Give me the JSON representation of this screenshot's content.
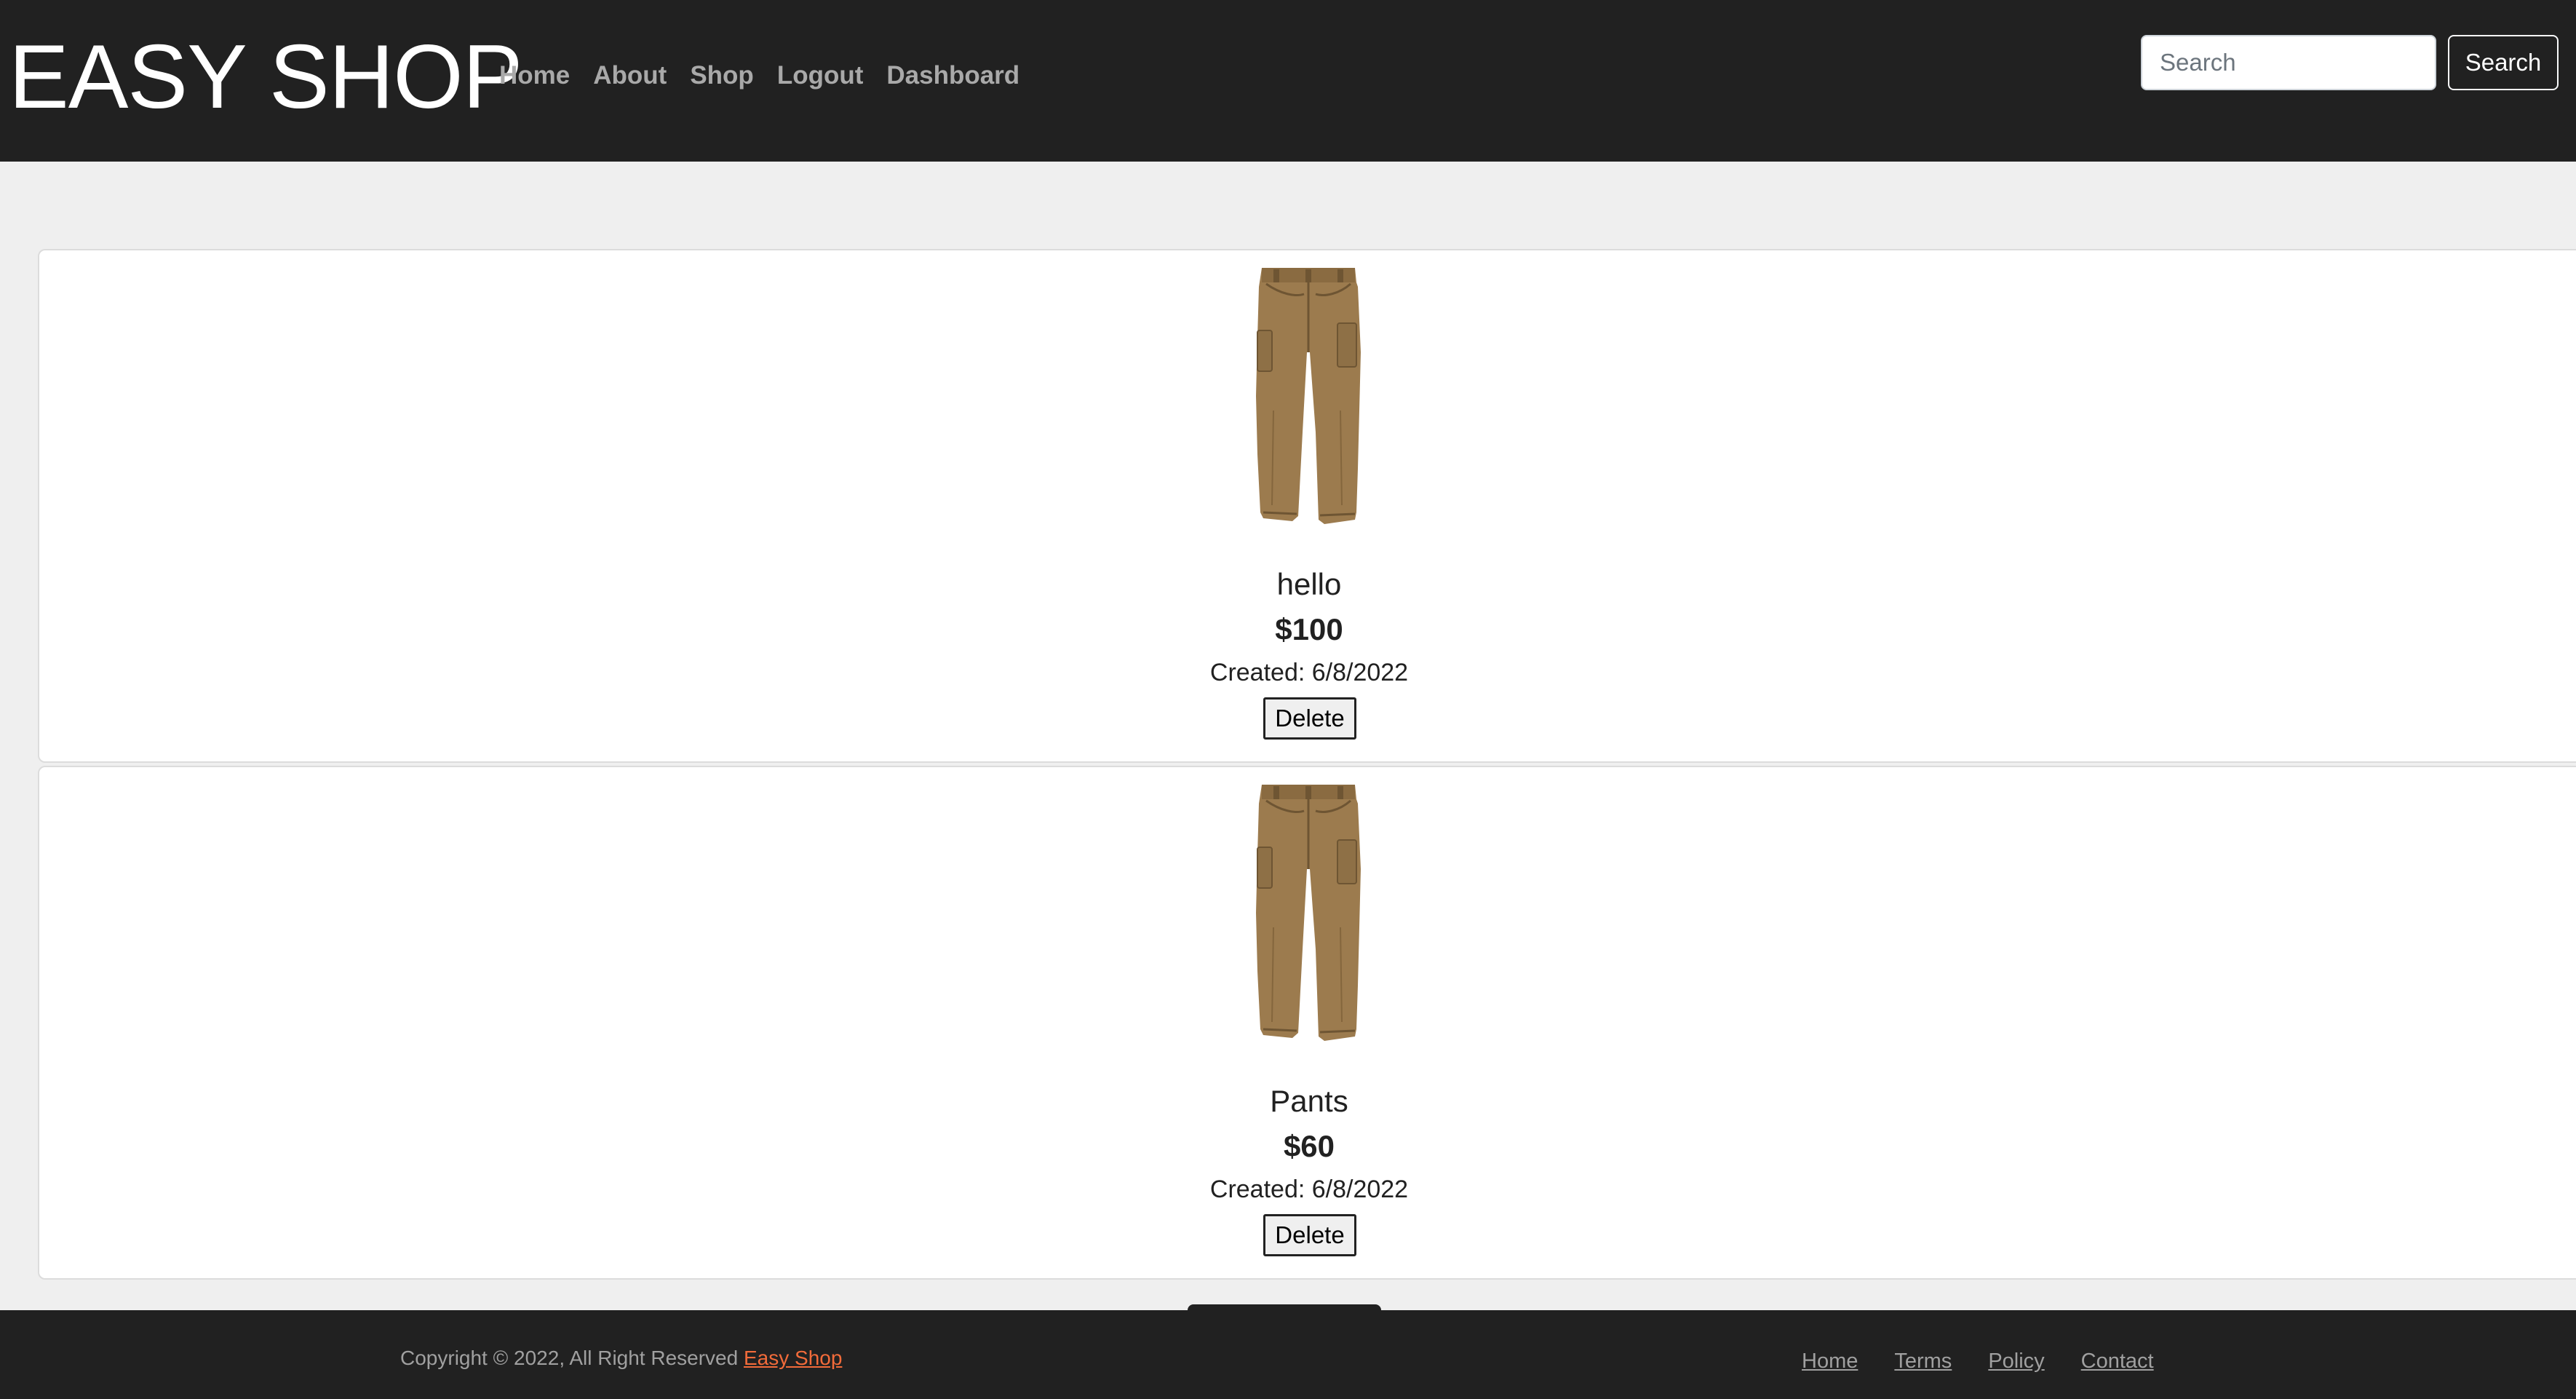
{
  "navbar": {
    "brand": "EASY SHOP",
    "links": [
      {
        "label": "Home"
      },
      {
        "label": "About"
      },
      {
        "label": "Shop"
      },
      {
        "label": "Logout"
      },
      {
        "label": "Dashboard"
      }
    ],
    "search": {
      "placeholder": "Search",
      "value": "",
      "button_label": "Search"
    }
  },
  "products": [
    {
      "name": "hello",
      "price": "$100",
      "created": "Created: 6/8/2022",
      "delete_label": "Delete",
      "image_icon": "cargo-pants-image"
    },
    {
      "name": "Pants",
      "price": "$60",
      "created": "Created: 6/8/2022",
      "delete_label": "Delete",
      "image_icon": "cargo-pants-image"
    }
  ],
  "footer": {
    "copyright_text": "Copyright © 2022, All Right Reserved",
    "copyright_link": "Easy Shop",
    "links": [
      {
        "label": "Home"
      },
      {
        "label": "Terms"
      },
      {
        "label": "Policy"
      },
      {
        "label": "Contact"
      }
    ]
  },
  "colors": {
    "navbar_bg": "#212121",
    "page_bg": "#efefef",
    "card_bg": "#ffffff",
    "nav_link": "#a9a9a9",
    "footer_accent": "#f26b3a",
    "pants": "#9c7b4e"
  }
}
